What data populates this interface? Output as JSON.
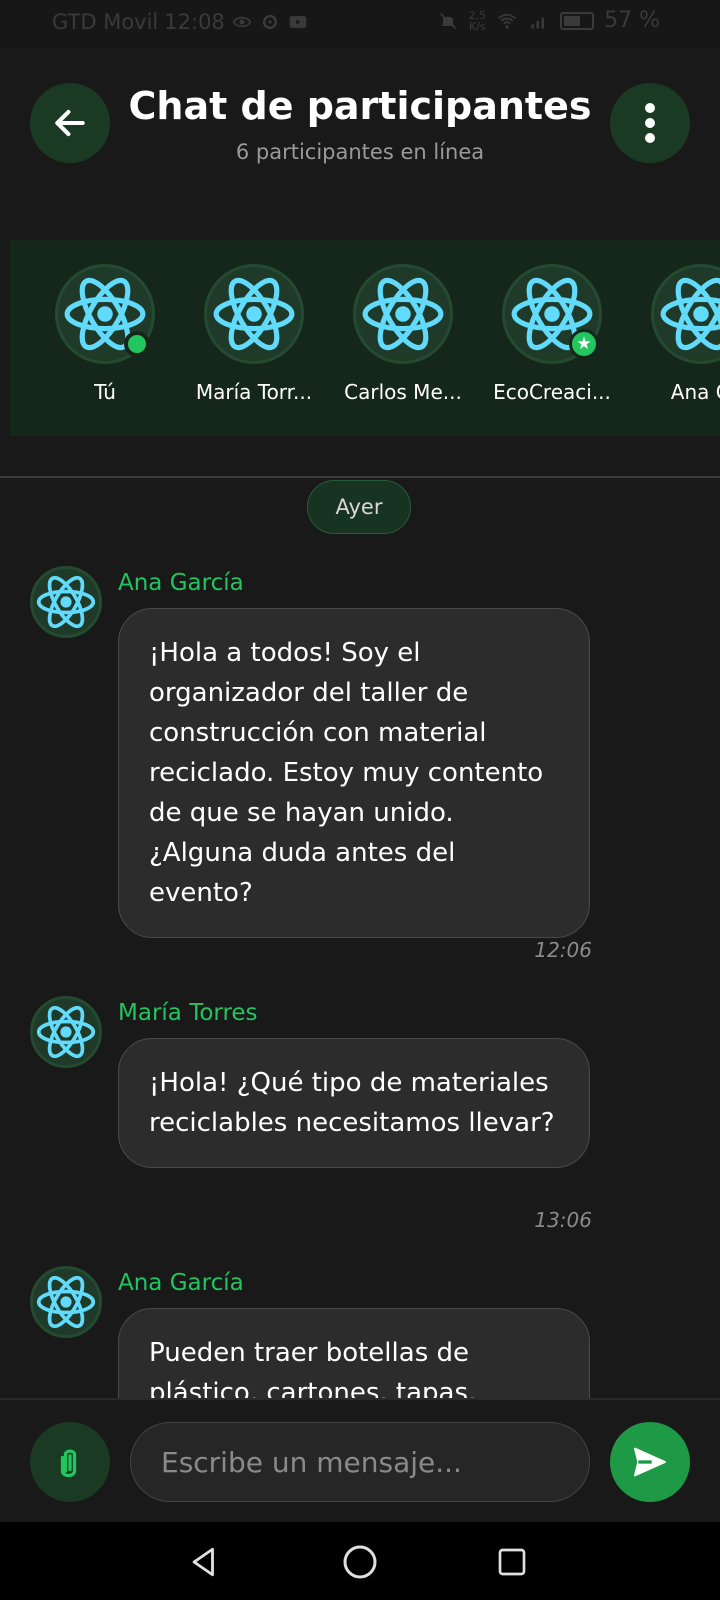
{
  "status_bar": {
    "carrier": "GTD Movil",
    "time": "12:08",
    "speed_value": "2,5",
    "speed_unit": "K/s",
    "battery": "57 %"
  },
  "header": {
    "title": "Chat de participantes",
    "subtitle": "6 participantes en línea",
    "back_icon": "arrow-left-icon",
    "menu_icon": "more-vertical-icon"
  },
  "participants": [
    {
      "name": "Tú",
      "badge": "online"
    },
    {
      "name": "María Torr...",
      "badge": ""
    },
    {
      "name": "Carlos Me...",
      "badge": ""
    },
    {
      "name": "EcoCreaci...",
      "badge": "star"
    },
    {
      "name": "Ana G",
      "badge": ""
    }
  ],
  "date_label": "Ayer",
  "messages": [
    {
      "sender": "Ana García",
      "text": "¡Hola a todos! Soy el organizador del taller de construcción con material reciclado. Estoy muy contento de que se hayan unido. ¿Alguna duda antes del evento?",
      "time": "12:06"
    },
    {
      "sender": "María Torres",
      "text": "¡Hola! ¿Qué tipo de materiales reciclables necesitamos llevar?",
      "time": "13:06"
    },
    {
      "sender": "Ana García",
      "text": "Pueden traer botellas de plástico, cartones, tapas,",
      "time": ""
    }
  ],
  "composer": {
    "placeholder": "Escribe un mensaje...",
    "value": ""
  },
  "colors": {
    "accent": "#22c55e",
    "header_button_bg": "#1a3a24",
    "send_button_bg": "#1e9a46",
    "background": "#191919",
    "bubble": "#2c2c2c"
  }
}
